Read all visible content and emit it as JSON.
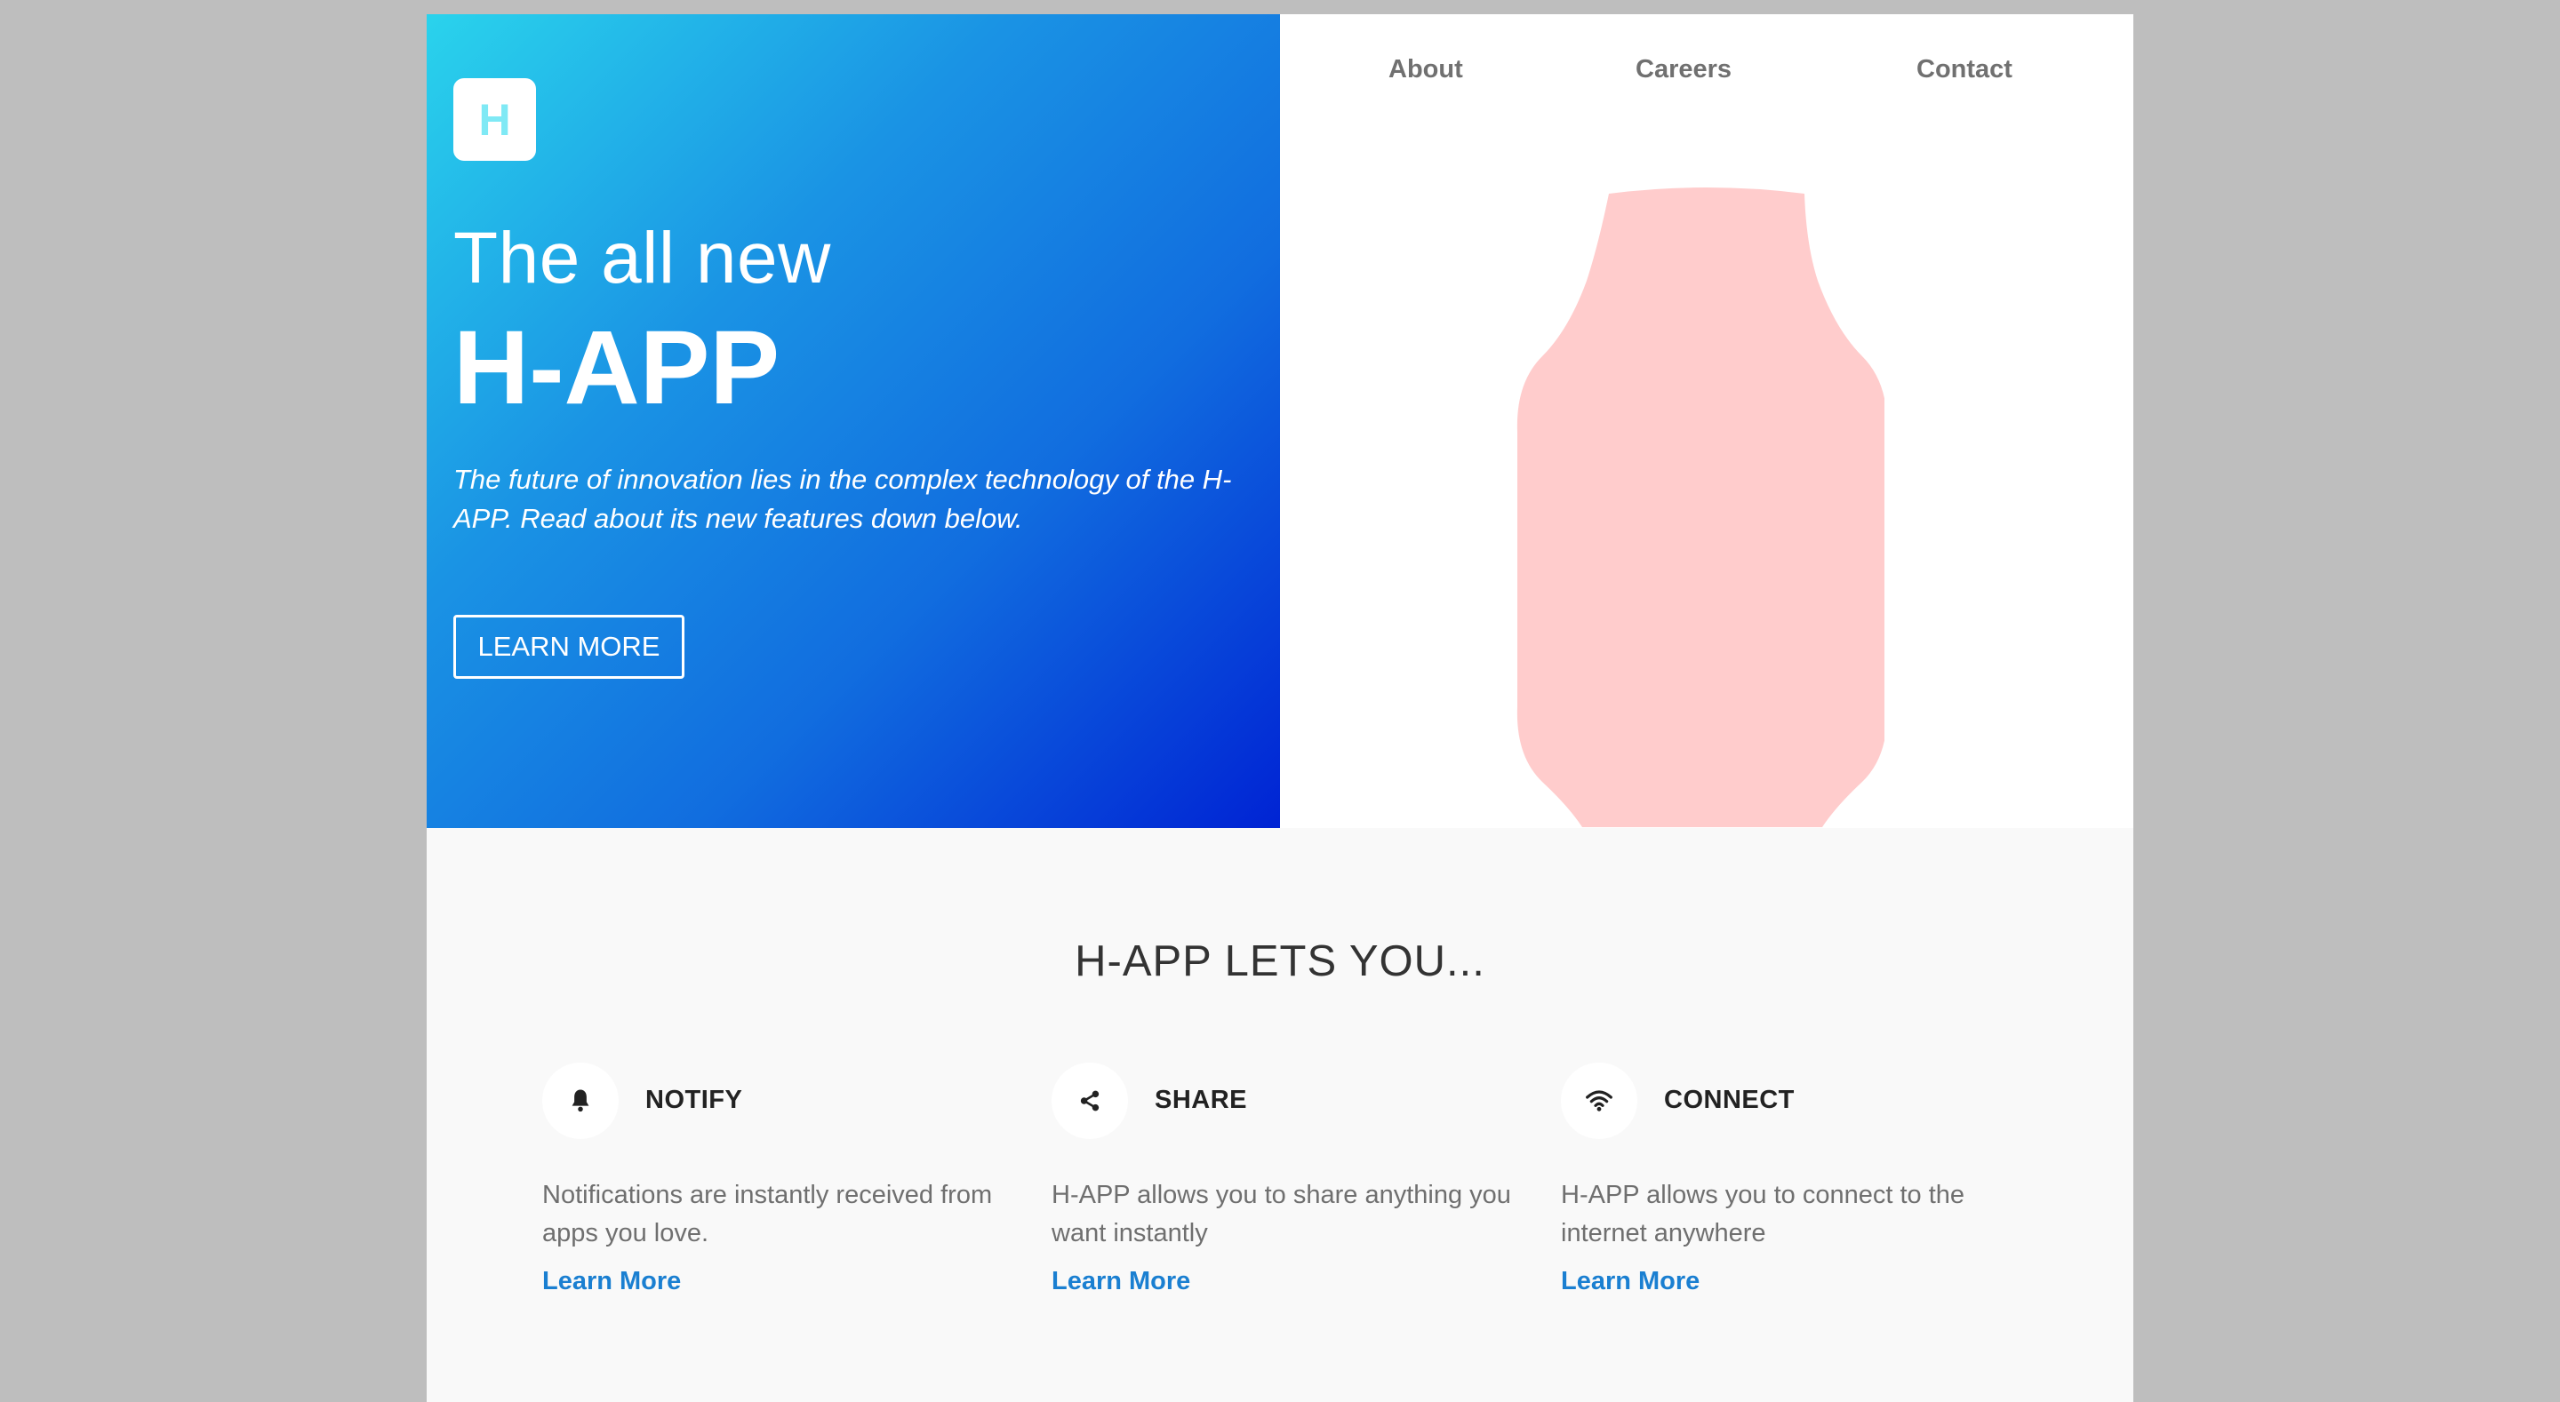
{
  "logo": {
    "letter": "H"
  },
  "hero": {
    "subtitle": "The all new",
    "title": "H-APP",
    "description": "The future of innovation lies in the complex technology of the H-APP. Read about its new features down below.",
    "button_label": "LEARN MORE"
  },
  "nav": {
    "about": "About",
    "careers": "Careers",
    "contact": "Contact"
  },
  "features_section": {
    "heading": "H-APP LETS YOU...",
    "items": [
      {
        "icon": "bell-icon",
        "title": "NOTIFY",
        "text": "Notifications are instantly received from apps you love.",
        "link": "Learn More"
      },
      {
        "icon": "share-icon",
        "title": "SHARE",
        "text": "H-APP allows you to share anything you want instantly",
        "link": "Learn More"
      },
      {
        "icon": "wifi-icon",
        "title": "CONNECT",
        "text": "H-APP allows you to connect to the internet anywhere",
        "link": "Learn More"
      }
    ]
  },
  "colors": {
    "gradient_start": "#2ad3ec",
    "gradient_end": "#0023d4",
    "watch": "#ffcccc",
    "link": "#1a7fd1"
  }
}
